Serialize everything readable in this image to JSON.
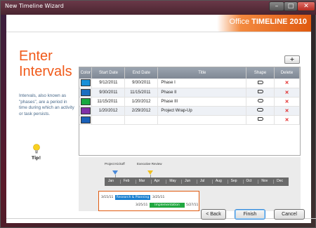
{
  "window": {
    "title": "New Timeline Wizard",
    "min": "–",
    "max": "□",
    "close": "✕"
  },
  "brand": {
    "office": "Office",
    "timeline": "TIMELINE 2010"
  },
  "left": {
    "heading_line1": "Enter",
    "heading_line2": "Intervals",
    "description": "Intervals, also known as \"phases\", are a period in time during which an activity or task persists.",
    "tip": "Tip!"
  },
  "toolbar": {
    "add_label": "+"
  },
  "table": {
    "headers": [
      "Color",
      "Start Date",
      "End Date",
      "Title",
      "Shape",
      "Delete"
    ],
    "rows": [
      {
        "color": "#1a90d8",
        "start": "9/12/2011",
        "end": "9/30/2011",
        "title": "Phase I",
        "shape": "banner",
        "delete": "✕"
      },
      {
        "color": "#1a6ec0",
        "start": "9/30/2011",
        "end": "11/15/2011",
        "title": "Phase II",
        "shape": "banner",
        "delete": "✕"
      },
      {
        "color": "#18a840",
        "start": "11/15/2011",
        "end": "1/20/2012",
        "title": "Phase III",
        "shape": "rounded",
        "delete": "✕"
      },
      {
        "color": "#8030a8",
        "start": "1/20/2012",
        "end": "2/29/2012",
        "title": "Project Wrap-Up",
        "shape": "arrow",
        "delete": "✕"
      },
      {
        "color": "#1a60b8",
        "start": "",
        "end": "",
        "title": "",
        "shape": "banner",
        "delete": "✕"
      }
    ]
  },
  "preview": {
    "milestones": [
      {
        "label": "Project Kickoff",
        "color": "#4b8ad8"
      },
      {
        "label": "Executive Review",
        "color": "#f0c020"
      }
    ],
    "months": [
      "Jan",
      "Feb",
      "Mar",
      "Apr",
      "May",
      "Jun",
      "Jul",
      "Aug",
      "Sep",
      "Oct",
      "Nov",
      "Dec"
    ],
    "tasks": [
      {
        "start": "3/15/11",
        "label": "Research & Planning",
        "end": "3/25/11",
        "color": "#1a80d0"
      },
      {
        "start": "3/25/11",
        "label": "Implementation",
        "end": "5/27/11",
        "color": "#20a840"
      }
    ]
  },
  "footer": {
    "back": "< Back",
    "finish": "Finish",
    "cancel": "Cancel"
  }
}
